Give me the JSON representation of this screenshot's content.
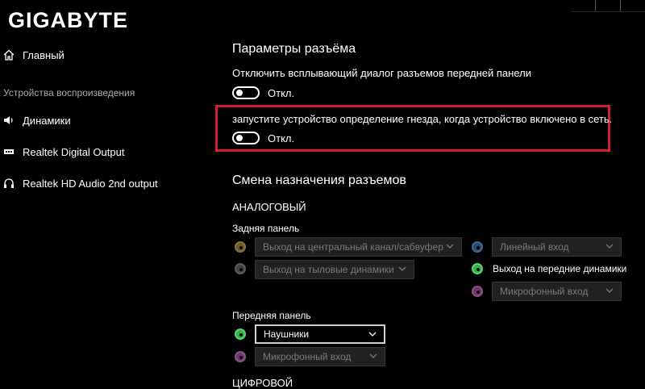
{
  "app": {
    "logo": "GIGABYTE"
  },
  "sidebar": {
    "main_label": "Главный",
    "section_caption": "Устройства воспроизведения",
    "items": [
      {
        "label": "Динамики",
        "icon": "speaker-icon"
      },
      {
        "label": "Realtek Digital Output",
        "icon": "digital-output-icon"
      },
      {
        "label": "Realtek HD Audio 2nd output",
        "icon": "headphones-icon"
      }
    ]
  },
  "connector_settings": {
    "title": "Параметры разъёма",
    "disable_popup_text": "Отключить всплывающий диалог разъемов передней панели",
    "disable_popup_state": "Откл.",
    "detect_text": "запустите устройство определение гнезда, когда  устройство включено в сеть.",
    "detect_state": "Откл."
  },
  "reassign": {
    "title": "Смена назначения разъемов",
    "analog_label": "АНАЛОГОВЫЙ",
    "rear_panel_label": "Задняя панель",
    "rear_left": [
      {
        "value": "Выход на центральный канал/сабвуфер",
        "jack_color": "orange"
      },
      {
        "value": "Выход на тыловые динамики",
        "jack_color": "gray"
      }
    ],
    "rear_right": [
      {
        "value": "Линейный вход",
        "jack_color": "blue",
        "type": "select"
      },
      {
        "value": "Выход на передние динамики",
        "jack_color": "green",
        "type": "text"
      },
      {
        "value": "Микрофонный вход",
        "jack_color": "pink",
        "type": "select"
      }
    ],
    "front_panel_label": "Передняя панель",
    "front": [
      {
        "value": "Наушники",
        "jack_color": "green",
        "active": true
      },
      {
        "value": "Микрофонный вход",
        "jack_color": "pink",
        "active": false
      }
    ],
    "digital_label": "ЦИФРОВОЙ"
  },
  "colors": {
    "highlight_border": "#d0202a",
    "background": "#000000"
  }
}
